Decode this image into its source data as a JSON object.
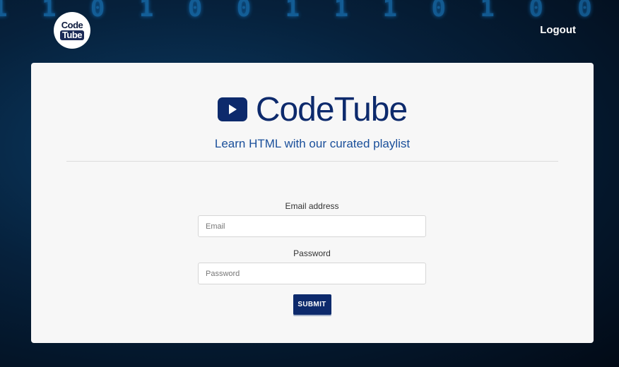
{
  "header": {
    "logo": {
      "line1": "Code",
      "line2": "Tube"
    },
    "logout_label": "Logout"
  },
  "card": {
    "brand_name": "CodeTube",
    "tagline": "Learn HTML with our curated playlist"
  },
  "form": {
    "email_label": "Email address",
    "email_placeholder": "Email",
    "email_value": "",
    "password_label": "Password",
    "password_placeholder": "Password",
    "password_value": "",
    "submit_label": "SUBMIT"
  },
  "icons": {
    "brand": "play-icon"
  },
  "colors": {
    "brand": "#0d2a6c",
    "tagline": "#1a4f9a",
    "card_background": "#f7f7f7"
  }
}
